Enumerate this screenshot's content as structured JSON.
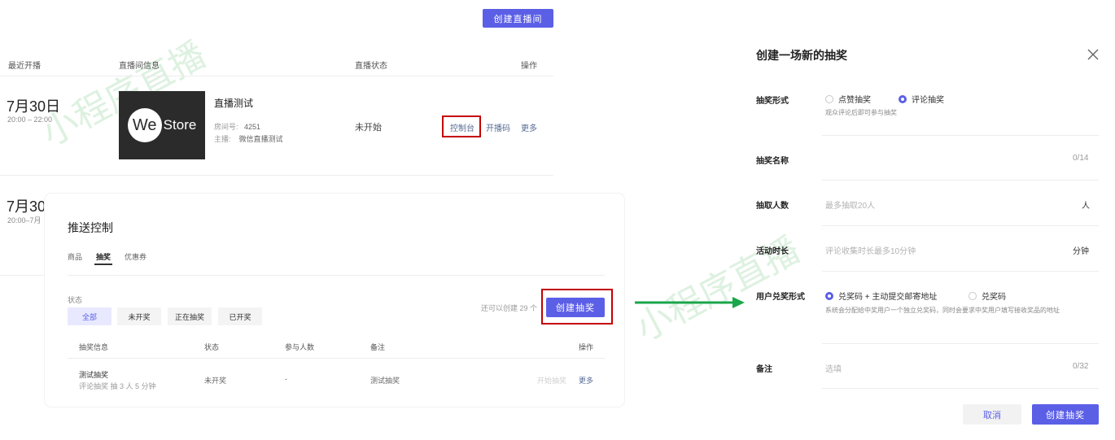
{
  "top": {
    "create_live_button": "创建直播间"
  },
  "live_table": {
    "headers": {
      "recent": "最近开播",
      "info": "直播间信息",
      "status": "直播状态",
      "ops": "操作"
    },
    "row1": {
      "date": "7月30日",
      "time": "20:00 – 22:00",
      "cover_we": "We",
      "cover_store": "Store",
      "title": "直播测试",
      "room_label": "房间号:",
      "room_value": "4251",
      "host_label": "主播:",
      "host_value": "微信直播测试",
      "status": "未开始",
      "op_console": "控制台",
      "op_code": "开播码",
      "op_more": "更多"
    },
    "row2": {
      "date": "7月30",
      "time": "20:00–7月"
    }
  },
  "push_panel": {
    "title": "推送控制",
    "tabs": [
      "商品",
      "抽奖",
      "优惠券"
    ],
    "status_label": "状态",
    "filters": [
      "全部",
      "未开奖",
      "正在抽奖",
      "已开奖"
    ],
    "remaining_text": "还可以创建 29 个",
    "create_lottery_button": "创建抽奖",
    "table_headers": {
      "info": "抽奖信息",
      "status": "状态",
      "participants": "参与人数",
      "remark": "备注",
      "ops": "操作"
    },
    "row": {
      "name": "测试抽奖",
      "desc": "评论抽奖 抽 3 人 5 分钟",
      "status": "未开奖",
      "participants": "-",
      "remark": "测试抽奖",
      "op_start": "开始抽奖",
      "op_more": "更多"
    }
  },
  "dialog": {
    "title": "创建一场新的抽奖",
    "form_label": "抽奖形式",
    "form_opt1": "点赞抽奖",
    "form_opt2": "评论抽奖",
    "form_help": "观众评论后即可参与抽奖",
    "name_label": "抽奖名称",
    "name_count": "0/14",
    "people_label": "抽取人数",
    "people_placeholder": "最多抽取20人",
    "people_unit": "人",
    "duration_label": "活动时长",
    "duration_placeholder": "评论收集时长最多10分钟",
    "duration_unit": "分钟",
    "redeem_label": "用户兑奖形式",
    "redeem_opt1": "兑奖码 + 主动提交邮寄地址",
    "redeem_opt2": "兑奖码",
    "redeem_help": "系统会分配给中奖用户一个独立兑奖码，同时会要求中奖用户填写接收奖品的地址",
    "remark_label": "备注",
    "remark_placeholder": "选填",
    "remark_count": "0/32",
    "cancel_button": "取消",
    "submit_button": "创建抽奖"
  },
  "watermark": {
    "text": "小程序直播"
  },
  "colors": {
    "accent": "#5b5fe6",
    "highlight": "#c40000",
    "arrow": "#1aa64a"
  }
}
